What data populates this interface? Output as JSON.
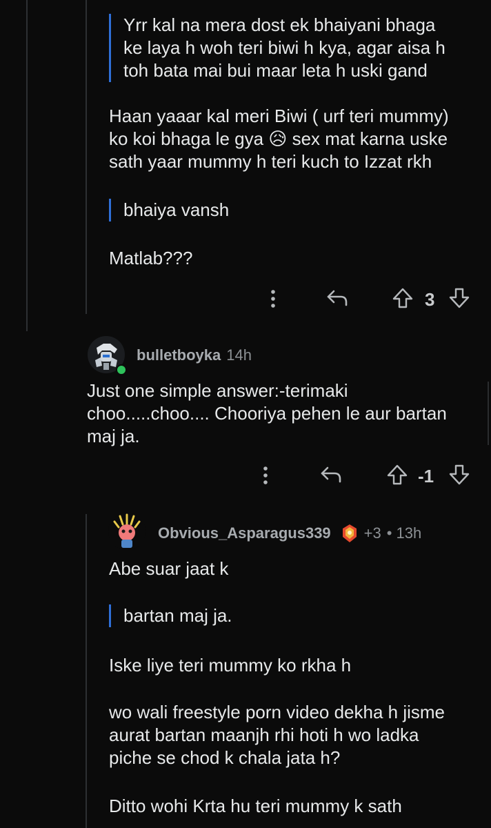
{
  "comment1": {
    "quote1": [
      "Yrr kal na mera dost ek bhaiyani bhaga",
      "ke laya h woh teri biwi h kya, agar aisa h",
      "toh bata mai bui maar leta h uski gand"
    ],
    "para1": [
      "Haan yaaar kal meri Biwi ( urf teri mummy)",
      "ko koi bhaga le gya 😥 sex mat karna uske",
      "sath yaar mummy h teri kuch to Izzat rkh"
    ],
    "quote2": "bhaiya vansh",
    "para2": "Matlab???",
    "score": "3"
  },
  "comment2": {
    "username": "bulletboyka",
    "time": "14h",
    "body": [
      "Just one simple answer:-terimaki",
      "choo.....choo.... Chooriya pehen le aur bartan",
      "maj ja."
    ],
    "score": "-1"
  },
  "comment3": {
    "username": "Obvious_Asparagus339",
    "karma": "+3",
    "time": "13h",
    "para1": "Abe suar jaat k",
    "quote": "bartan maj ja.",
    "para2": "Iske liye teri mummy ko rkha h",
    "para3": [
      "wo wali freestyle porn video dekha h jisme",
      "aurat bartan maanjh rhi hoti h wo ladka",
      "piche se chod k chala jata h?"
    ],
    "para4": "Ditto wohi Krta hu teri mummy k sath"
  },
  "colors": {
    "quote_bar": "#2f6fd8",
    "online": "#2ec25b",
    "background": "#0b0b0b"
  },
  "icons": [
    "more-icon",
    "reply-icon",
    "upvote-icon",
    "downvote-icon",
    "award-icon"
  ]
}
